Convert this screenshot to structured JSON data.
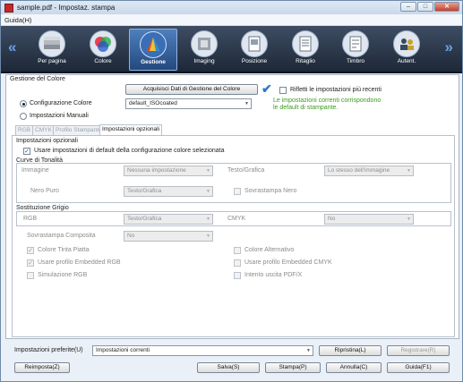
{
  "window": {
    "title": "sample.pdf - Impostaz. stampa",
    "min": "–",
    "max": "□",
    "close": "✕"
  },
  "menu": {
    "guide": "Guida(H)"
  },
  "toolbar": {
    "items": [
      {
        "label": "Per pagina",
        "icon": "stack-icon"
      },
      {
        "label": "Colore",
        "icon": "color-wheel-icon"
      },
      {
        "label": "Gestione",
        "icon": "color-management-icon"
      },
      {
        "label": "Imaging",
        "icon": "imaging-icon"
      },
      {
        "label": "Posizione",
        "icon": "position-icon"
      },
      {
        "label": "Ritaglio",
        "icon": "crop-icon"
      },
      {
        "label": "Timbro",
        "icon": "stamp-icon"
      },
      {
        "label": "Autent.",
        "icon": "users-icon"
      }
    ],
    "left_arrow": "«",
    "right_arrow": "»"
  },
  "color_mgmt": {
    "section": "Gestione del Colore",
    "acquire_button": "Acquisisci Dati di Gestione del Colore",
    "check": "✔",
    "radio_config": "Configurazione Colore",
    "config_value": "default_ISOcoated",
    "reflect_label": "Rifletti le impostazioni più recenti",
    "info_line1": "Le impostazioni correnti corrispondono",
    "info_line2": "le default di stampante.",
    "radio_manual": "Impostazioni Manuali"
  },
  "tabs": [
    "RGB",
    "CMYK",
    "Profilo Stampante",
    "Impostazioni opzionali"
  ],
  "optional": {
    "group": "Impostazioni opzionali",
    "use_default": "Usare impostazioni di default della configurazione colore selezionata",
    "curves": "Curve di Tonalità",
    "image": "Immagine",
    "image_value": "Nessuna impostazione",
    "text_graphics": "Testo/Grafica",
    "text_value": "Lo stesso dell'immagine",
    "pure_black": "Nero Puro",
    "pure_black_value": "Testo/Grafica",
    "overprint_black": "Sovrastampa Nero",
    "gray_replace": "Sostituzione Grigio",
    "rgb": "RGB",
    "rgb_value": "Testo/Grafica",
    "cmyk": "CMYK",
    "cmyk_value": "No",
    "composite_overprint": "Sovrastampa Composita",
    "composite_value": "No",
    "spot_color": "Colore Tinta Piatta",
    "alt_color": "Colore Alternativo",
    "rgb_embedded": "Usare profilo Embedded RGB",
    "cmyk_embedded": "Usare profilo Embedded CMYK",
    "rgb_sim": "Simulazione RGB",
    "pdfx_intent": "Intento uscita PDF/X"
  },
  "footer": {
    "pref_label": "Impostazioni preferite(U)",
    "pref_value": "Impostazioni correnti",
    "restore": "Ripristina(L)",
    "register": "Registrare(R)",
    "reset": "Reimposta(Z)",
    "save": "Salva(S)",
    "print": "Stampa(P)",
    "cancel": "Annulla(C)",
    "help": "Guida(F1)"
  }
}
